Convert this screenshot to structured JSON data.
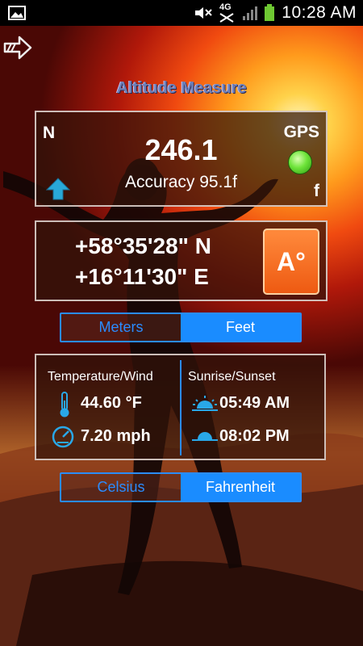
{
  "status_bar": {
    "time": "10:28 AM",
    "network": "4G",
    "icons": [
      "gallery-icon",
      "mute-icon",
      "no-sim-icon",
      "signal-icon",
      "battery-icon"
    ]
  },
  "header": {
    "title": "Altitude Measure"
  },
  "altitude": {
    "north_label": "N",
    "value": "246.1",
    "accuracy": "Accuracy 95.1f",
    "gps_label": "GPS",
    "gps_status_color": "#6ee43a",
    "unit": "f"
  },
  "coordinates": {
    "latitude": "+58°35'28\" N",
    "longitude": "+16°11'30\" E",
    "mode_button": "A°"
  },
  "units_toggle": {
    "meters": "Meters",
    "feet": "Feet",
    "selected": "Feet"
  },
  "weather": {
    "temp_wind_header": "Temperature/Wind",
    "temperature": "44.60 °F",
    "wind": "7.20 mph",
    "sun_header": "Sunrise/Sunset",
    "sunrise": "05:49 AM",
    "sunset": "08:02 PM"
  },
  "temp_toggle": {
    "celsius": "Celsius",
    "fahrenheit": "Fahrenheit",
    "selected": "Fahrenheit"
  },
  "colors": {
    "accent": "#1a8cff",
    "button_orange": "#ee5a12"
  }
}
